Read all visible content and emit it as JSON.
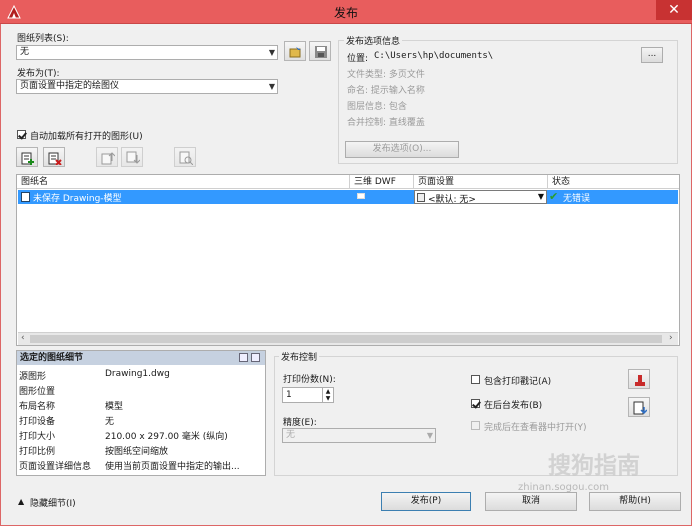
{
  "window": {
    "title": "发布",
    "close": "✕"
  },
  "sheet_list": {
    "label": "图纸列表(S):",
    "value": "无"
  },
  "publish_to": {
    "label": "发布为(T):",
    "value": "页面设置中指定的绘图仪"
  },
  "options_info": {
    "header": "发布选项信息",
    "location_label": "位置:",
    "location_value": "C:\\Users\\hp\\documents\\",
    "browse": "...",
    "file_type": "文件类型: 多页文件",
    "naming": "命名: 提示输入名称",
    "layer_info": "图层信息: 包含",
    "merge": "合并控制: 直线覆盖",
    "publish_options_btn": "发布选项(O)..."
  },
  "auto_load": {
    "label": "自动加载所有打开的图形(U)",
    "checked": true
  },
  "table": {
    "headers": [
      "图纸名",
      "三维 DWF",
      "页面设置",
      "状态"
    ],
    "rows": [
      {
        "name": "未保存 Drawing-模型",
        "page_setup": "<默认: 无>",
        "status": "无错误"
      }
    ]
  },
  "details": {
    "header": "选定的图纸细节",
    "items": [
      {
        "key": "源图形",
        "value": "Drawing1.dwg"
      },
      {
        "key": "图形位置",
        "value": ""
      },
      {
        "key": "布局名称",
        "value": "模型"
      },
      {
        "key": "打印设备",
        "value": "无"
      },
      {
        "key": "打印大小",
        "value": "210.00 x 297.00 毫米 (纵向)"
      },
      {
        "key": "打印比例",
        "value": "按图纸空间缩放"
      },
      {
        "key": "页面设置详细信息",
        "value": "使用当前页面设置中指定的输出..."
      }
    ]
  },
  "publish_control": {
    "header": "发布控制",
    "copies_label": "打印份数(N):",
    "copies_value": "1",
    "precision_label": "精度(E):",
    "precision_value": "无",
    "include_stamp": {
      "label": "包含打印戳记(A)",
      "checked": false
    },
    "background_publish": {
      "label": "在后台发布(B)",
      "checked": true
    },
    "open_in_viewer": {
      "label": "完成后在查看器中打开(Y)",
      "checked": false
    }
  },
  "footer": {
    "hide_details": "隐藏细节(I)",
    "publish": "发布(P)",
    "cancel": "取消",
    "help": "帮助(H)"
  },
  "watermark": {
    "text": "搜狗指南",
    "url": "zhinan.sogou.com"
  },
  "colors": {
    "titlebar": "#e85d5d",
    "selection": "#3399ff",
    "status_ok": "#2a9d2a"
  }
}
